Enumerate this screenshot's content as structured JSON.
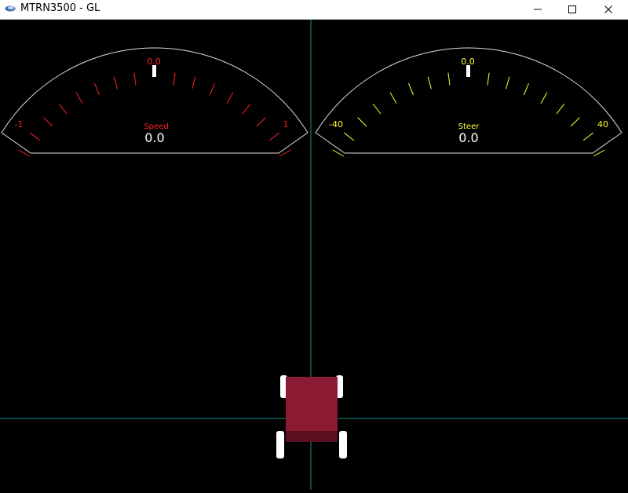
{
  "window": {
    "title": "MTRN3500 - GL",
    "controls": {
      "minimize": "minimize-icon",
      "maximize": "maximize-icon",
      "close": "close-icon"
    }
  },
  "colors": {
    "background": "#000000",
    "crosshair": "#1a8c8c",
    "gauge_outline": "#dddddd",
    "speed": "#ff2020",
    "steer": "#ffff33",
    "value": "#ffffff",
    "vehicle_body": "#8b1a33",
    "vehicle_rear": "#5a1020",
    "wheel": "#ffffff"
  },
  "gauges": {
    "speed": {
      "label": "Speed",
      "value_text": "0.0",
      "pointer_text": "0.0",
      "min_label": "-1",
      "max_label": "1",
      "min": -1,
      "max": 1,
      "value": 0.0
    },
    "steer": {
      "label": "Steer",
      "value_text": "0.0",
      "pointer_text": "0.0",
      "min_label": "-40",
      "max_label": "40",
      "min": -40,
      "max": 40,
      "value": 0.0
    }
  }
}
